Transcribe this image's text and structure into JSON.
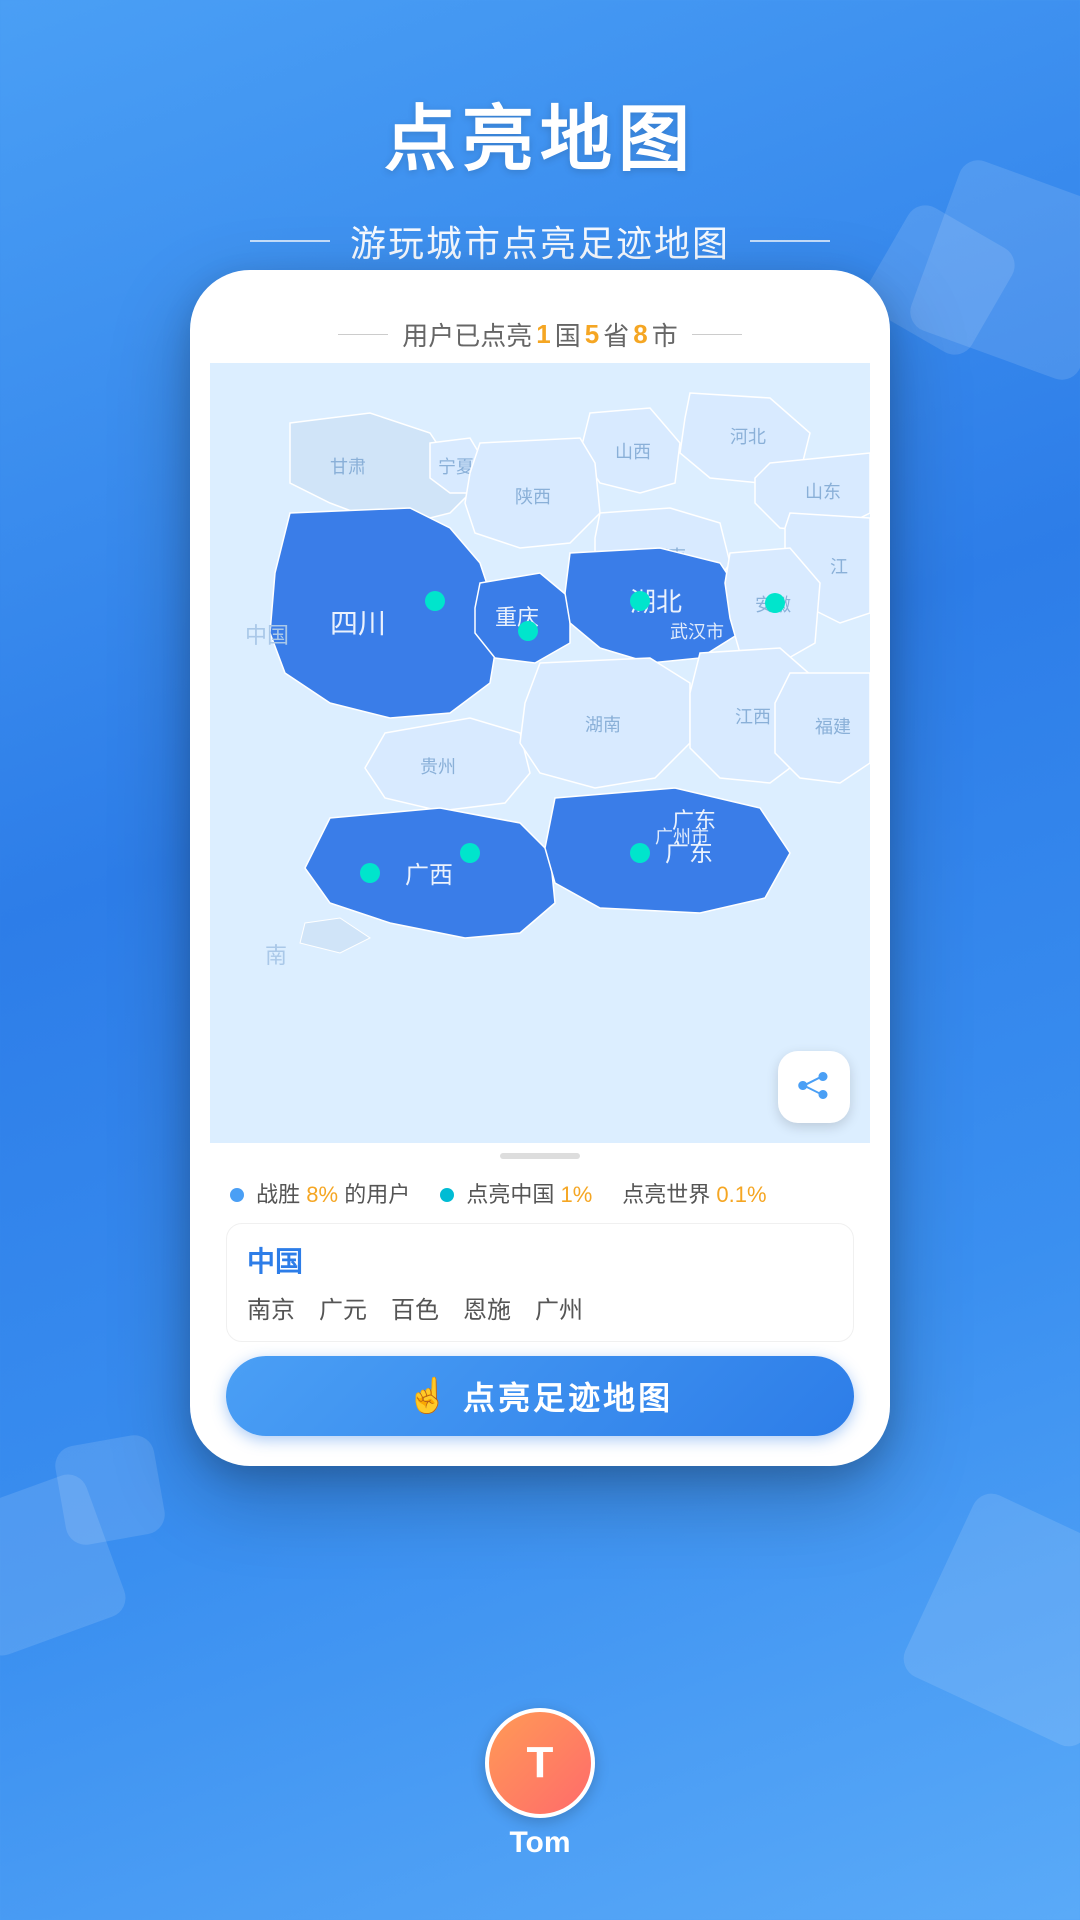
{
  "header": {
    "main_title": "点亮地图",
    "subtitle": "游玩城市点亮足迹地图"
  },
  "stats_bar": {
    "prefix": "用户已点亮",
    "country_num": "1",
    "country_label": "国",
    "province_num": "5",
    "province_label": "省",
    "city_num": "8",
    "city_label": "市"
  },
  "bottom_stats": {
    "beat_label": "战胜",
    "beat_pct": "8%",
    "beat_suffix": "的用户",
    "china_label": "点亮中国",
    "china_pct": "1%",
    "world_label": "点亮世界",
    "world_pct": "0.1%"
  },
  "location_card": {
    "title": "中国",
    "cities": [
      "南京",
      "广元",
      "百色",
      "恩施",
      "广州"
    ]
  },
  "cta_button": {
    "label": "点亮足迹地图"
  },
  "user": {
    "name": "Tom",
    "initials": "T"
  },
  "map_regions": {
    "highlighted": [
      "四川",
      "湖北",
      "广东",
      "广西",
      "重庆"
    ],
    "light": [
      "甘肃",
      "宁夏",
      "陕西",
      "山西",
      "河北",
      "山东",
      "河南",
      "安徽",
      "湖南",
      "贵州",
      "江西",
      "福建"
    ],
    "labels": {
      "gansu": "甘肃",
      "ningxia": "宁夏",
      "shaanxi": "陕西",
      "shanxi": "山西",
      "hebei": "河北",
      "shandong": "山东",
      "henan": "河南",
      "sichuan": "四川",
      "chongqing": "重庆",
      "hubei": "湖北",
      "anhui": "安徽",
      "hunan": "湖南",
      "guizhou": "贵州",
      "guangxi": "广西",
      "guangdong": "广东",
      "jiangxi": "江西",
      "fujian": "福建",
      "china": "中国",
      "nan": "南",
      "wuhan": "武汉市",
      "guangzhou": "广州市"
    }
  }
}
